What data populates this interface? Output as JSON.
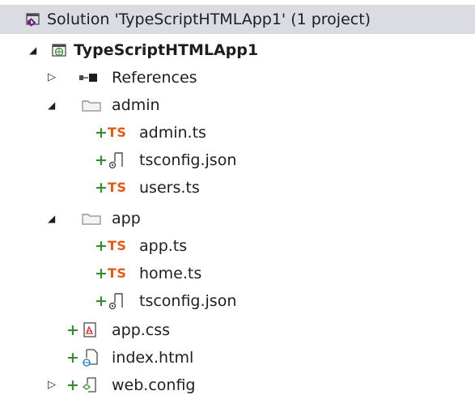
{
  "solution": {
    "label": "Solution 'TypeScriptHTMLApp1' (1 project)",
    "icon": "visual-studio-solution-icon"
  },
  "project": {
    "label": "TypeScriptHTMLApp1",
    "icon": "web-project-globe-icon",
    "expander": "◢"
  },
  "references": {
    "label": "References",
    "icon": "references-icon",
    "expander": "▷"
  },
  "admin_folder": {
    "label": "admin",
    "icon": "folder-icon",
    "expander": "◢",
    "files": {
      "admin_ts": {
        "label": "admin.ts",
        "badge": "TS",
        "pending": "+"
      },
      "tsconfig": {
        "label": "tsconfig.json",
        "pending": "+"
      },
      "users_ts": {
        "label": "users.ts",
        "badge": "TS",
        "pending": "+"
      }
    }
  },
  "app_folder": {
    "label": "app",
    "icon": "folder-icon",
    "expander": "◢",
    "files": {
      "app_ts": {
        "label": "app.ts",
        "badge": "TS",
        "pending": "+"
      },
      "home_ts": {
        "label": "home.ts",
        "badge": "TS",
        "pending": "+"
      },
      "tsconfig": {
        "label": "tsconfig.json",
        "pending": "+"
      }
    }
  },
  "app_css": {
    "label": "app.css",
    "pending": "+"
  },
  "index_html": {
    "label": "index.html",
    "pending": "+"
  },
  "web_config": {
    "label": "web.config",
    "pending": "+",
    "expander": "▷"
  },
  "colors": {
    "selection": "#dadbe3",
    "ts_badge": "#e05a12",
    "pending_add": "#388a34",
    "vs_purple": "#68217a"
  }
}
